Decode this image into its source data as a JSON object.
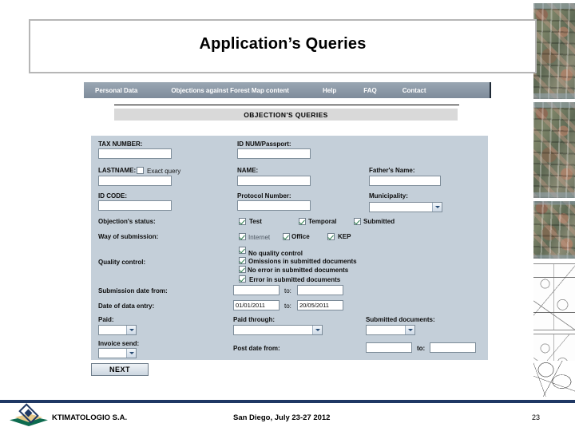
{
  "slide": {
    "title": "Application’s Queries"
  },
  "app": {
    "nav": [
      {
        "label": "Personal Data"
      },
      {
        "label": "Objections against Forest Map content"
      },
      {
        "label": "Help"
      },
      {
        "label": "FAQ"
      },
      {
        "label": "Contact"
      }
    ],
    "section_title": "OBJECTION'S QUERIES",
    "fields": {
      "tax_number": {
        "label": "TAX NUMBER:",
        "value": ""
      },
      "id_num_passport": {
        "label": "ID NUM/Passport:",
        "value": ""
      },
      "lastname": {
        "label": "LASTNAME:",
        "value": ""
      },
      "exact_query": {
        "label": "Exact query",
        "checked": false
      },
      "name": {
        "label": "NAME:",
        "value": ""
      },
      "fathers_name": {
        "label": "Father's Name:",
        "value": ""
      },
      "id_code": {
        "label": "ID CODE:",
        "value": ""
      },
      "protocol_number": {
        "label": "Protocol Number:",
        "value": ""
      },
      "municipality": {
        "label": "Municipality:",
        "value": ""
      }
    },
    "objection_status": {
      "label": "Objection's status:",
      "options": [
        {
          "label": "Test",
          "checked": true
        },
        {
          "label": "Temporal",
          "checked": true
        },
        {
          "label": "Submitted",
          "checked": true
        }
      ]
    },
    "way_of_submission": {
      "label": "Way of submission:",
      "options": [
        {
          "label": "Internet",
          "checked": true
        },
        {
          "label": "Office",
          "checked": true
        },
        {
          "label": "KEP",
          "checked": true
        }
      ]
    },
    "quality_control": {
      "label": "Quality control:",
      "options": [
        {
          "label": "No quality control",
          "checked": true
        },
        {
          "label": "Omissions in submitted documents",
          "checked": true
        },
        {
          "label": "No error in submitted documents",
          "checked": true
        },
        {
          "label": "Error in submitted documents",
          "checked": true
        }
      ]
    },
    "submission_date": {
      "label": "Submission date from:",
      "to_label": "to:",
      "from_value": "",
      "to_value": ""
    },
    "data_entry_date": {
      "label": "Date of data entry:",
      "to_label": "to:",
      "from_value": "01/01/2011",
      "to_value": "20/05/2011"
    },
    "paid": {
      "label": "Paid:",
      "value": ""
    },
    "paid_through": {
      "label": "Paid through:",
      "value": ""
    },
    "submitted_documents": {
      "label": "Submitted documents:",
      "value": ""
    },
    "invoice_send": {
      "label": "Invoice send:",
      "value": ""
    },
    "post_date": {
      "label": "Post date from:",
      "to_label": "to:",
      "from_value": "",
      "to_value": ""
    },
    "next_button": "NEXT"
  },
  "footer": {
    "company": "KTIMATOLOGIO S.A.",
    "event": "San Diego, July 23-27 2012",
    "page_number": "23"
  }
}
